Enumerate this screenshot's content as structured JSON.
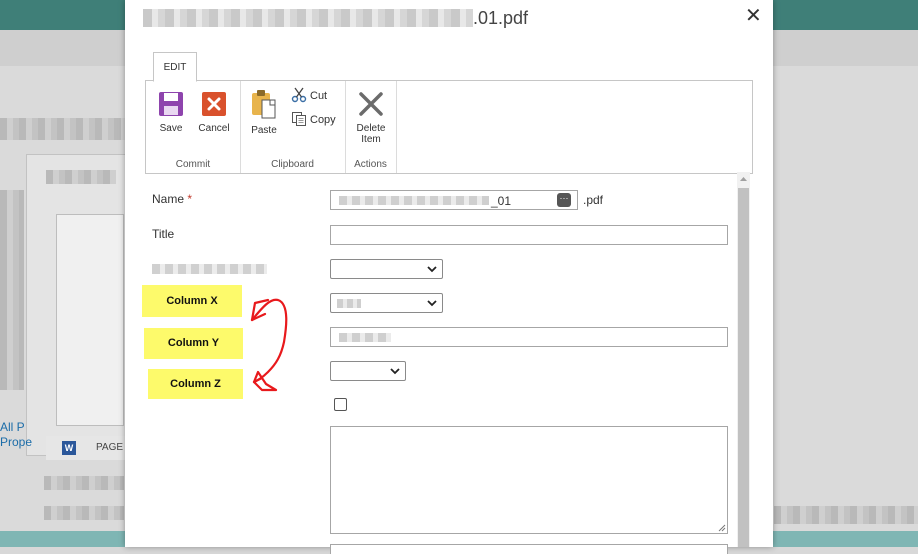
{
  "background": {
    "link_text_line1": "All P",
    "link_text_line2": "Prope",
    "word_icon_letter": "W",
    "word_bar_text": "PAGE"
  },
  "dialog": {
    "title_suffix": ".01.pdf",
    "close_glyph": "✕"
  },
  "ribbon": {
    "tab_label": "EDIT",
    "groups": {
      "commit": "Commit",
      "clipboard": "Clipboard",
      "actions": "Actions"
    },
    "buttons": {
      "save": "Save",
      "cancel": "Cancel",
      "paste": "Paste",
      "cut": "Cut",
      "copy": "Copy",
      "delete_line1": "Delete",
      "delete_line2": "Item"
    }
  },
  "form": {
    "name_label": "Name",
    "name_required": "*",
    "name_value_suffix": "_01",
    "name_ext": ".pdf",
    "name_icon_glyph": "···",
    "title_label": "Title",
    "column_x": "Column X",
    "column_y": "Column Y",
    "column_z": "Column Z"
  },
  "colors": {
    "highlight": "#fdfa6b",
    "annotation": "#e8191c",
    "header_teal": "#3f7f78"
  }
}
